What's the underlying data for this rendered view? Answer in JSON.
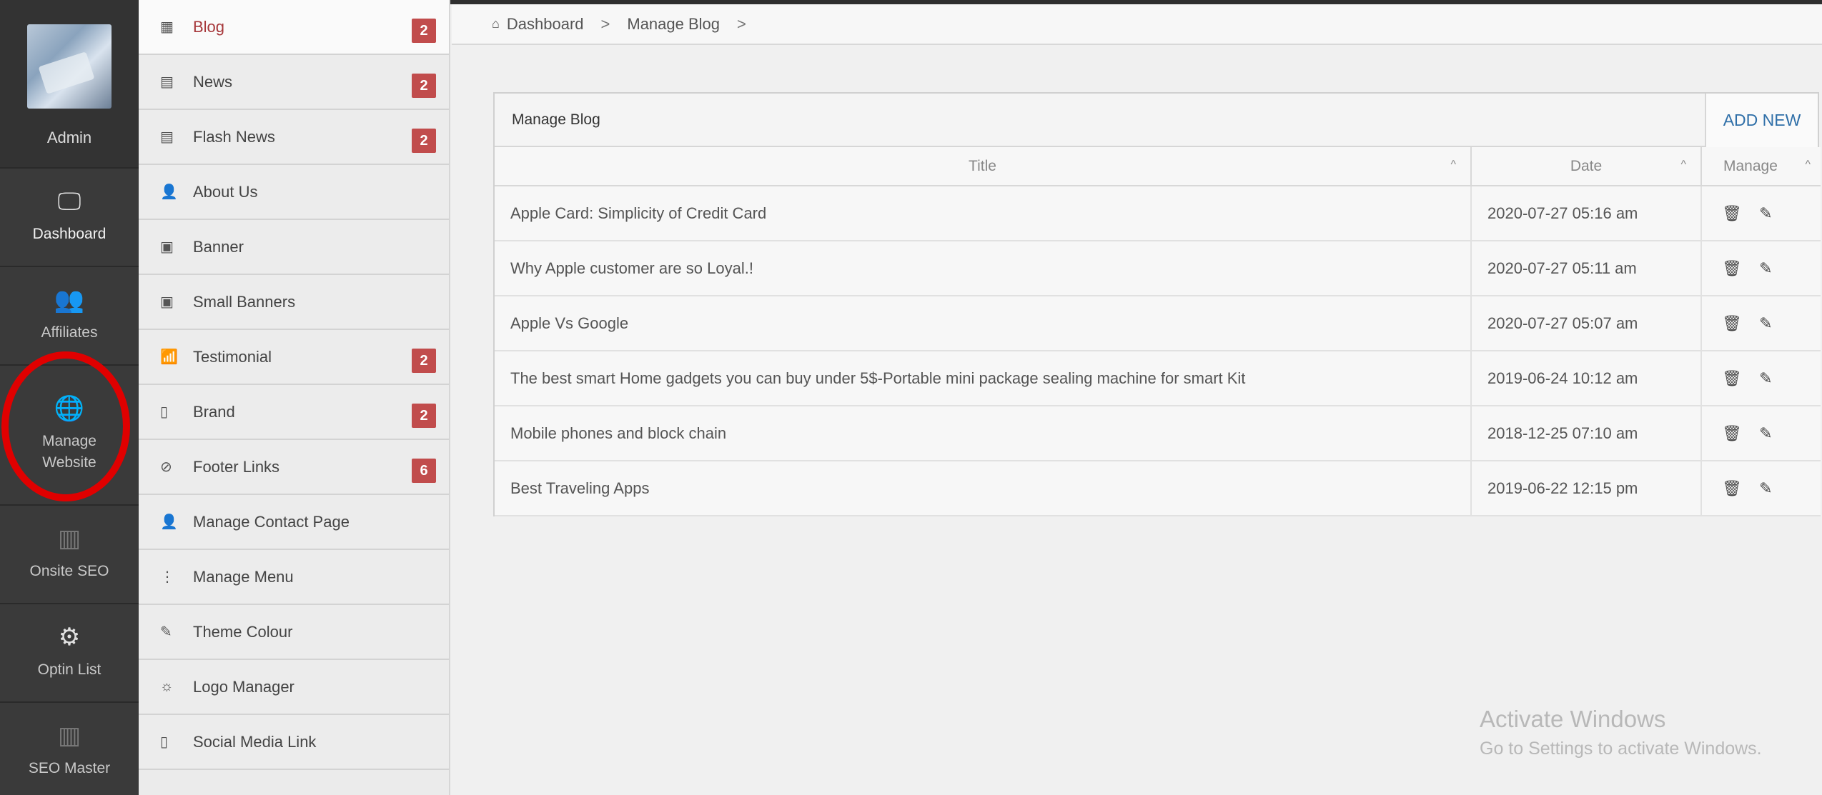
{
  "rail": {
    "admin_label": "Admin",
    "items": [
      {
        "label": "Dashboard",
        "icon": "monitor-icon",
        "glyph": "🖵"
      },
      {
        "label": "Affiliates",
        "icon": "users-icon",
        "glyph": "👥"
      },
      {
        "label": "Manage Website",
        "icon": "globe-icon",
        "glyph": "🌐"
      },
      {
        "label": "Onsite SEO",
        "icon": "bar-chart-icon",
        "glyph": "▥"
      },
      {
        "label": "Optin List",
        "icon": "settings-sun-icon",
        "glyph": "⚙"
      },
      {
        "label": "SEO Master",
        "icon": "bar-chart-icon",
        "glyph": "▥"
      }
    ]
  },
  "submenu": {
    "items": [
      {
        "label": "Blog",
        "icon": "calendar-icon",
        "glyph": "▦",
        "badge": "2"
      },
      {
        "label": "News",
        "icon": "newspaper-icon",
        "glyph": "▤",
        "badge": "2"
      },
      {
        "label": "Flash News",
        "icon": "newspaper-icon",
        "glyph": "▤",
        "badge": "2"
      },
      {
        "label": "About Us",
        "icon": "user-icon",
        "glyph": "👤",
        "badge": ""
      },
      {
        "label": "Banner",
        "icon": "image-icon",
        "glyph": "▣",
        "badge": ""
      },
      {
        "label": "Small Banners",
        "icon": "image-icon",
        "glyph": "▣",
        "badge": ""
      },
      {
        "label": "Testimonial",
        "icon": "signal-icon",
        "glyph": "📶",
        "badge": "2"
      },
      {
        "label": "Brand",
        "icon": "mobile-icon",
        "glyph": "▯",
        "badge": "2"
      },
      {
        "label": "Footer Links",
        "icon": "link-icon",
        "glyph": "⊘",
        "badge": "6"
      },
      {
        "label": "Manage Contact Page",
        "icon": "add-user-icon",
        "glyph": "👤",
        "badge": ""
      },
      {
        "label": "Manage Menu",
        "icon": "vertical-dots-icon",
        "glyph": "⋮",
        "badge": ""
      },
      {
        "label": "Theme Colour",
        "icon": "pencil-icon",
        "glyph": "✎",
        "badge": ""
      },
      {
        "label": "Logo Manager",
        "icon": "sun-icon",
        "glyph": "☼",
        "badge": ""
      },
      {
        "label": "Social Media Link",
        "icon": "mobile-icon",
        "glyph": "▯",
        "badge": ""
      }
    ]
  },
  "breadcrumb": {
    "home_glyph": "⌂",
    "items": [
      "Dashboard",
      "Manage Blog"
    ],
    "separator": ">"
  },
  "panel": {
    "title": "Manage Blog",
    "add_new_label": "ADD NEW",
    "columns": [
      "Title",
      "Date",
      "Manage"
    ],
    "sort_glyph": "^",
    "rows": [
      {
        "title": "Apple Card: Simplicity of Credit Card",
        "date": "2020-07-27 05:16 am"
      },
      {
        "title": "Why Apple customer are so Loyal.!",
        "date": "2020-07-27 05:11 am"
      },
      {
        "title": "Apple Vs Google",
        "date": "2020-07-27 05:07 am"
      },
      {
        "title": "The best smart Home gadgets you can buy under 5$-Portable mini package sealing machine for smart Kit",
        "date": "2019-06-24 10:12 am"
      },
      {
        "title": "Mobile phones and block chain",
        "date": "2018-12-25 07:10 am"
      },
      {
        "title": "Best Traveling Apps",
        "date": "2019-06-22 12:15 pm"
      }
    ],
    "delete_glyph": "🗑",
    "edit_glyph": "✎"
  },
  "watermark": {
    "line1": "Activate Windows",
    "line2": "Go to Settings to activate Windows."
  }
}
